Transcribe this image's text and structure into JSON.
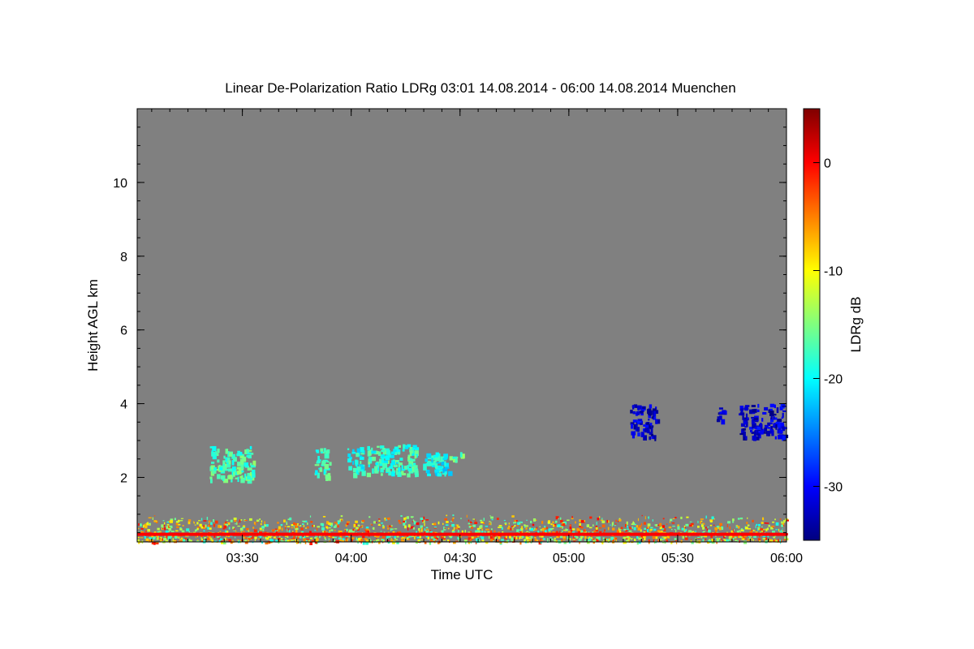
{
  "chart_data": {
    "type": "heatmap",
    "title": "Linear De-Polarization Ratio LDRg   03:01 14.08.2014 - 06:00 14.08.2014 Muenchen",
    "xlabel": "Time UTC",
    "ylabel": "Height AGL km",
    "colorbar_label": "LDRg dB",
    "x_range_hours": [
      3.0167,
      6.0
    ],
    "y_range_km": [
      0.25,
      12.0
    ],
    "x_ticks": [
      {
        "value": 3.5,
        "label": "03:30"
      },
      {
        "value": 4.0,
        "label": "04:00"
      },
      {
        "value": 4.5,
        "label": "04:30"
      },
      {
        "value": 5.0,
        "label": "05:00"
      },
      {
        "value": 5.5,
        "label": "05:30"
      },
      {
        "value": 6.0,
        "label": "06:00"
      }
    ],
    "y_ticks": [
      {
        "value": 2,
        "label": "2"
      },
      {
        "value": 4,
        "label": "4"
      },
      {
        "value": 6,
        "label": "6"
      },
      {
        "value": 8,
        "label": "8"
      },
      {
        "value": 10,
        "label": "10"
      }
    ],
    "colorbar_range": [
      -35,
      5
    ],
    "colorbar_ticks": [
      {
        "value": 0,
        "label": "0"
      },
      {
        "value": -10,
        "label": "-10"
      },
      {
        "value": -20,
        "label": "-20"
      },
      {
        "value": -30,
        "label": "-30"
      }
    ],
    "colormap": "jet",
    "background_color": "#808080",
    "features": [
      {
        "t0": 3.35,
        "t1": 3.55,
        "h0": 1.95,
        "h1": 2.85,
        "ldr": -17
      },
      {
        "t0": 3.83,
        "t1": 3.9,
        "h0": 2.0,
        "h1": 2.8,
        "ldr": -18
      },
      {
        "t0": 3.98,
        "t1": 4.05,
        "h0": 2.1,
        "h1": 2.85,
        "ldr": -19
      },
      {
        "t0": 4.07,
        "t1": 4.3,
        "h0": 2.1,
        "h1": 2.9,
        "ldr": -18
      },
      {
        "t0": 4.33,
        "t1": 4.45,
        "h0": 2.1,
        "h1": 2.7,
        "ldr": -20
      },
      {
        "t0": 4.45,
        "t1": 4.52,
        "h0": 2.5,
        "h1": 2.7,
        "ldr": -16
      },
      {
        "t0": 5.28,
        "t1": 5.4,
        "h0": 3.1,
        "h1": 4.0,
        "ldr": -32
      },
      {
        "t0": 5.67,
        "t1": 5.71,
        "h0": 3.5,
        "h1": 3.9,
        "ldr": -32
      },
      {
        "t0": 5.78,
        "t1": 5.99,
        "h0": 3.1,
        "h1": 4.0,
        "ldr": -32
      }
    ],
    "boundary_layer": {
      "t0": 3.0167,
      "t1": 6.0,
      "h0": 0.25,
      "h1": 1.0,
      "ldr_range": [
        -20,
        0
      ]
    }
  }
}
